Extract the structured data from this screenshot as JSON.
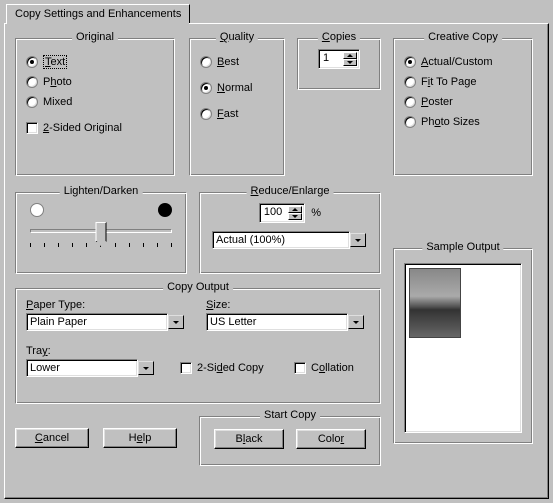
{
  "tab": {
    "label": "Copy Settings and Enhancements"
  },
  "original": {
    "title": "Original",
    "text": "Text",
    "photo": "Photo",
    "mixed": "Mixed",
    "two_sided": "2-Sided Original",
    "selected": "text"
  },
  "quality": {
    "title": "Quality",
    "best": "Best",
    "normal": "Normal",
    "fast": "Fast",
    "selected": "normal"
  },
  "copies": {
    "title": "Copies",
    "value": "1"
  },
  "creative": {
    "title": "Creative Copy",
    "actual": "Actual/Custom",
    "fit": "Fit To Page",
    "poster": "Poster",
    "photo_sizes": "Photo Sizes",
    "selected": "actual"
  },
  "lighten": {
    "title": "Lighten/Darken",
    "position_pct": 50
  },
  "reduce": {
    "title": "Reduce/Enlarge",
    "value": "100",
    "pct": "%",
    "preset": "Actual (100%)"
  },
  "output": {
    "title": "Copy Output",
    "paper_type_label": "Paper Type:",
    "paper_type": "Plain Paper",
    "size_label": "Size:",
    "size": "US Letter",
    "tray_label": "Tray:",
    "tray": "Lower",
    "two_sided_copy": "2-Sided Copy",
    "collation": "Collation"
  },
  "start": {
    "title": "Start Copy",
    "black": "Black",
    "color": "Color"
  },
  "sample": {
    "title": "Sample Output"
  },
  "buttons": {
    "cancel": "Cancel",
    "help": "Help"
  },
  "u": {
    "t": "T",
    "b": "B",
    "n": "N",
    "f": "F",
    "c": "C",
    "r": "R",
    "a": "A",
    "i": "i",
    "p": "P",
    "h": "h",
    "s": "S",
    "l": "l",
    "e": "e",
    "o": "o",
    "2": "2"
  }
}
